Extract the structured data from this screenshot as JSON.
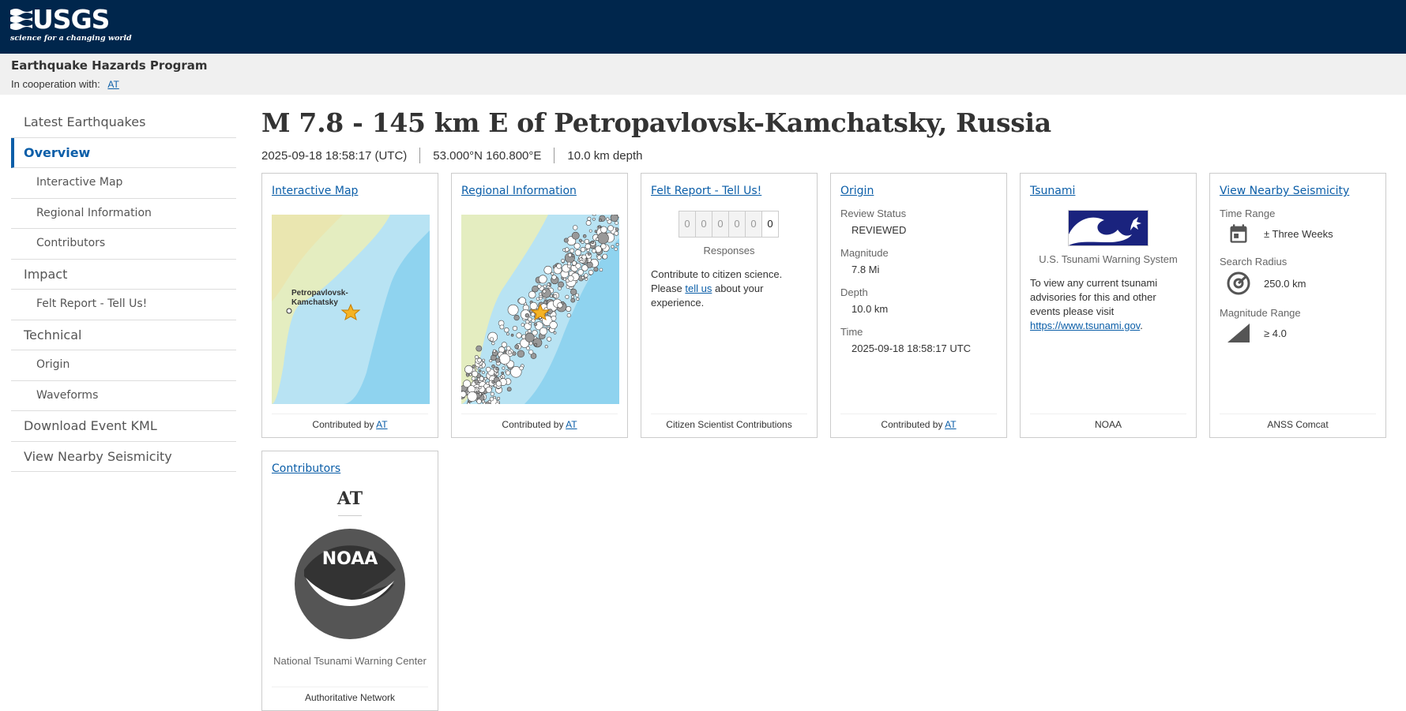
{
  "header": {
    "logo_text": "USGS",
    "logo_tagline": "science for a changing world",
    "program_title": "Earthquake Hazards Program",
    "coop_label": "In cooperation with:",
    "coop_link": "AT"
  },
  "sidebar": {
    "items": [
      {
        "label": "Latest Earthquakes"
      },
      {
        "label": "Overview"
      },
      {
        "label": "Interactive Map"
      },
      {
        "label": "Regional Information"
      },
      {
        "label": "Contributors"
      },
      {
        "label": "Impact"
      },
      {
        "label": "Felt Report - Tell Us!"
      },
      {
        "label": "Technical"
      },
      {
        "label": "Origin"
      },
      {
        "label": "Waveforms"
      },
      {
        "label": "Download Event KML"
      },
      {
        "label": "View Nearby Seismicity"
      }
    ]
  },
  "event": {
    "title": "M 7.8 - 145 km E of Petropavlovsk-Kamchatsky, Russia",
    "time": "2025-09-18 18:58:17 (UTC)",
    "coords": "53.000°N 160.800°E",
    "depth": "10.0 km depth"
  },
  "cards": {
    "interactive_map": {
      "title": "Interactive Map",
      "map_label_1": "Petropavlovsk-",
      "map_label_2": "Kamchatsky",
      "footer_prefix": "Contributed by",
      "footer_link": "AT"
    },
    "regional": {
      "title": "Regional Information",
      "footer_prefix": "Contributed by",
      "footer_link": "AT"
    },
    "felt": {
      "title": "Felt Report - Tell Us!",
      "digits": [
        "0",
        "0",
        "0",
        "0",
        "0",
        "0"
      ],
      "responses_label": "Responses",
      "text_before": "Contribute to citizen science. Please",
      "text_link": "tell us",
      "text_after": "about your experience.",
      "footer": "Citizen Scientist Contributions"
    },
    "origin": {
      "title": "Origin",
      "review_label": "Review Status",
      "review_value": "REVIEWED",
      "magnitude_label": "Magnitude",
      "magnitude_value": "7.8 Mi",
      "depth_label": "Depth",
      "depth_value": "10.0 km",
      "time_label": "Time",
      "time_value": "2025-09-18 18:58:17 UTC",
      "footer_prefix": "Contributed by",
      "footer_link": "AT"
    },
    "tsunami": {
      "title": "Tsunami",
      "system_name": "U.S. Tsunami Warning System",
      "text_before": "To view any current tsunami advisories for this and other events please visit",
      "text_link": "https://www.tsunami.gov",
      "text_after": ".",
      "footer": "NOAA"
    },
    "nearby": {
      "title": "View Nearby Seismicity",
      "time_range_label": "Time Range",
      "time_range_value": "± Three Weeks",
      "radius_label": "Search Radius",
      "radius_value": "250.0 km",
      "mag_range_label": "Magnitude Range",
      "mag_range_value": "≥ 4.0",
      "footer": "ANSS Comcat"
    },
    "contributors": {
      "title": "Contributors",
      "name": "AT",
      "logo_text": "NOAA",
      "org": "National Tsunami Warning Center",
      "footer": "Authoritative Network"
    }
  },
  "colors": {
    "header_bg": "#00264c",
    "link": "#0b5ea8",
    "program_bg": "#f0f0f0"
  }
}
